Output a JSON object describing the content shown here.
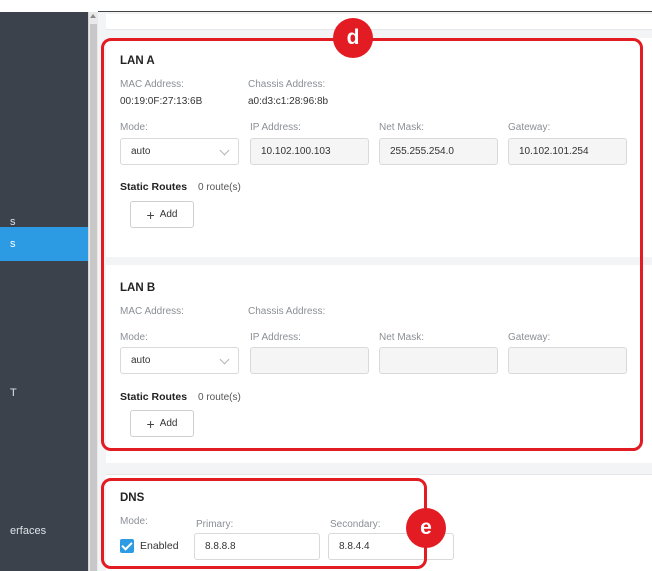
{
  "sidebar": {
    "items": [
      {
        "label": "s"
      },
      {
        "label": "s"
      },
      {
        "label": "T"
      },
      {
        "label": ""
      },
      {
        "label": "erfaces"
      }
    ]
  },
  "lan_a": {
    "title": "LAN A",
    "mac_label": "MAC Address:",
    "mac_value": "00:19:0F:27:13:6B",
    "chassis_label": "Chassis Address:",
    "chassis_value": "a0:d3:c1:28:96:8b",
    "mode_label": "Mode:",
    "mode_value": "auto",
    "ip_label": "IP Address:",
    "ip_value": "10.102.100.103",
    "mask_label": "Net Mask:",
    "mask_value": "255.255.254.0",
    "gateway_label": "Gateway:",
    "gateway_value": "10.102.101.254",
    "static_routes_label": "Static Routes",
    "static_routes_count": "0 route(s)",
    "add_label": "Add"
  },
  "lan_b": {
    "title": "LAN B",
    "mac_label": "MAC Address:",
    "chassis_label": "Chassis Address:",
    "mode_label": "Mode:",
    "mode_value": "auto",
    "ip_label": "IP Address:",
    "mask_label": "Net Mask:",
    "gateway_label": "Gateway:",
    "static_routes_label": "Static Routes",
    "static_routes_count": "0 route(s)",
    "add_label": "Add"
  },
  "dns": {
    "title": "DNS",
    "mode_label": "Mode:",
    "enabled_label": "Enabled",
    "enabled": true,
    "primary_label": "Primary:",
    "primary_value": "8.8.8.8",
    "secondary_label": "Secondary:",
    "secondary_value": "8.8.4.4"
  },
  "annotations": {
    "d": "d",
    "e": "e"
  },
  "colors": {
    "accent": "#2d9be3",
    "highlight": "#e31b23",
    "sidebar_bg": "#3b424c"
  }
}
